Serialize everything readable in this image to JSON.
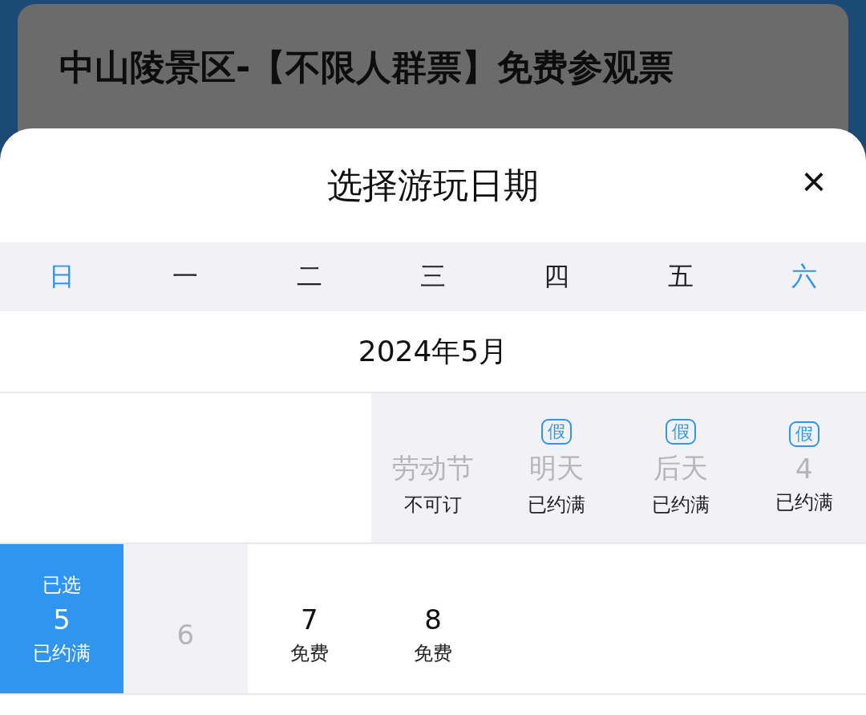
{
  "ticket": {
    "title": "中山陵景区-【不限人群票】免费参观票"
  },
  "sheet": {
    "title": "选择游玩日期",
    "close": "×",
    "weekdays": [
      {
        "label": "日",
        "weekend": true
      },
      {
        "label": "一",
        "weekend": false
      },
      {
        "label": "二",
        "weekend": false
      },
      {
        "label": "三",
        "weekend": false
      },
      {
        "label": "四",
        "weekend": false
      },
      {
        "label": "五",
        "weekend": false
      },
      {
        "label": "六",
        "weekend": true
      }
    ],
    "month": "2024年5月",
    "weeks": [
      [
        {
          "kind": "blank"
        },
        {
          "kind": "blank"
        },
        {
          "kind": "blank"
        },
        {
          "kind": "day",
          "label": "劳动节",
          "note": "不可订",
          "disabled": true,
          "selected": false
        },
        {
          "kind": "day",
          "badge": "假",
          "label": "明天",
          "note": "已约满",
          "disabled": true,
          "selected": false
        },
        {
          "kind": "day",
          "badge": "假",
          "label": "后天",
          "note": "已约满",
          "disabled": true,
          "selected": false
        },
        {
          "kind": "day",
          "badge": "假",
          "label": "4",
          "note": "已约满",
          "disabled": true,
          "selected": false
        }
      ],
      [
        {
          "kind": "day",
          "caption": "已选",
          "label": "5",
          "note": "已约满",
          "disabled": false,
          "selected": true
        },
        {
          "kind": "day",
          "label": "6",
          "disabled": true,
          "selected": false
        },
        {
          "kind": "day",
          "label": "7",
          "note": "免费",
          "disabled": false,
          "selected": false
        },
        {
          "kind": "day",
          "label": "8",
          "note": "免费",
          "disabled": false,
          "selected": false
        },
        {
          "kind": "blank"
        },
        {
          "kind": "blank"
        },
        {
          "kind": "blank"
        }
      ]
    ]
  }
}
